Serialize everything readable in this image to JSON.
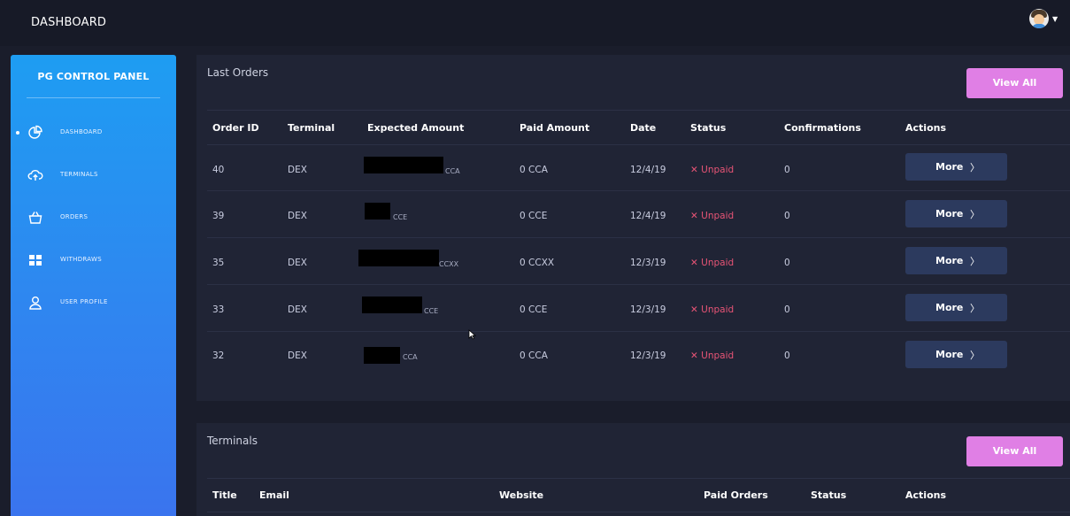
{
  "header": {
    "title": "DASHBOARD"
  },
  "sidebar": {
    "title": "PG CONTROL PANEL",
    "items": [
      {
        "label": "DASHBOARD",
        "icon": "pie-chart-icon",
        "active": true
      },
      {
        "label": "TERMINALS",
        "icon": "cloud-upload-icon",
        "active": false
      },
      {
        "label": "ORDERS",
        "icon": "basket-icon",
        "active": false
      },
      {
        "label": "WITHDRAWS",
        "icon": "wallet-icon",
        "active": false
      },
      {
        "label": "USER PROFILE",
        "icon": "user-icon",
        "active": false
      }
    ]
  },
  "last_orders": {
    "title": "Last Orders",
    "view_all_label": "View All",
    "columns": [
      "Order ID",
      "Terminal",
      "Expected Amount",
      "Paid Amount",
      "Date",
      "Status",
      "Confirmations",
      "Actions"
    ],
    "rows": [
      {
        "order_id": "40",
        "terminal": "DEX",
        "expected_suffix": "CCA",
        "paid": "0",
        "paid_unit": "CCA",
        "date": "12/4/19",
        "status": "Unpaid",
        "confirmations": "0",
        "action": "More"
      },
      {
        "order_id": "39",
        "terminal": "DEX",
        "expected_suffix": "CCE",
        "paid": "0",
        "paid_unit": "CCE",
        "date": "12/4/19",
        "status": "Unpaid",
        "confirmations": "0",
        "action": "More"
      },
      {
        "order_id": "35",
        "terminal": "DEX",
        "expected_suffix": "CCXX",
        "paid": "0",
        "paid_unit": "CCXX",
        "date": "12/3/19",
        "status": "Unpaid",
        "confirmations": "0",
        "action": "More"
      },
      {
        "order_id": "33",
        "terminal": "DEX",
        "expected_suffix": "CCE",
        "paid": "0",
        "paid_unit": "CCE",
        "date": "12/3/19",
        "status": "Unpaid",
        "confirmations": "0",
        "action": "More"
      },
      {
        "order_id": "32",
        "terminal": "DEX",
        "expected_suffix": "CCA",
        "paid": "0",
        "paid_unit": "CCA",
        "date": "12/3/19",
        "status": "Unpaid",
        "confirmations": "0",
        "action": "More"
      }
    ]
  },
  "terminals": {
    "title": "Terminals",
    "view_all_label": "View All",
    "columns": [
      "Title",
      "Email",
      "Website",
      "Paid Orders",
      "Status",
      "Actions"
    ]
  },
  "colors": {
    "accent_pink": "#e07fe5",
    "sidebar_blue": "#2f86f0",
    "unpaid_red": "#e85476",
    "panel_bg": "#202435"
  }
}
